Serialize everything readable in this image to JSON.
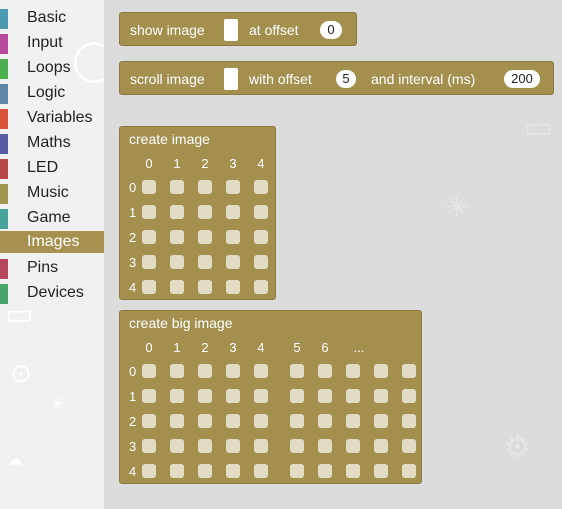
{
  "sidebar": {
    "items": [
      {
        "label": "Basic",
        "color": "#4a9ab4"
      },
      {
        "label": "Input",
        "color": "#b8489c"
      },
      {
        "label": "Loops",
        "color": "#4caf50"
      },
      {
        "label": "Logic",
        "color": "#5b86a5"
      },
      {
        "label": "Variables",
        "color": "#d9533a"
      },
      {
        "label": "Maths",
        "color": "#5a5aa5"
      },
      {
        "label": "LED",
        "color": "#b84848"
      },
      {
        "label": "Music",
        "color": "#a3974f"
      },
      {
        "label": "Game",
        "color": "#4aa39a"
      },
      {
        "label": "Images",
        "color": "#a79151",
        "selected": true
      },
      {
        "label": "Pins",
        "color": "#b5465c"
      },
      {
        "label": "Devices",
        "color": "#4aa56b"
      }
    ]
  },
  "blocks": {
    "show_image": {
      "label": "show image",
      "offset_label": "at offset",
      "offset_value": "0"
    },
    "scroll_image": {
      "label": "scroll image",
      "offset_label": "with offset",
      "offset_value": "5",
      "interval_label": "and interval (ms)",
      "interval_value": "200"
    },
    "create_image": {
      "label": "create image",
      "columns": [
        "0",
        "1",
        "2",
        "3",
        "4"
      ],
      "rows": [
        "0",
        "1",
        "2",
        "3",
        "4"
      ]
    },
    "create_big_image": {
      "label": "create big image",
      "columns": [
        "0",
        "1",
        "2",
        "3",
        "4",
        "5",
        "6",
        "..."
      ],
      "rows": [
        "0",
        "1",
        "2",
        "3",
        "4"
      ]
    }
  },
  "colors": {
    "block": "#a38f4e",
    "selected": "#a79151",
    "cell": "#e3dcc4"
  }
}
